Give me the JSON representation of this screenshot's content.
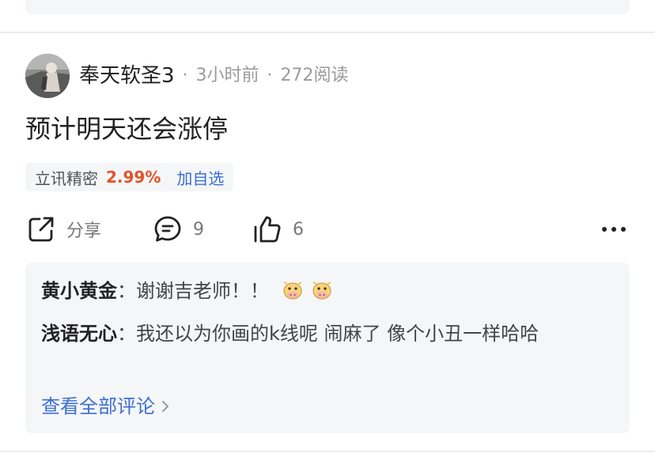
{
  "post": {
    "author": {
      "name": "奉天软圣3",
      "avatar_icon": "avatar-photo"
    },
    "time": "3小时前",
    "reads": "272阅读",
    "content": "预计明天还会涨停",
    "stock": {
      "name": "立讯精密",
      "change": "2.99%",
      "change_color": "#e0542a",
      "add_label": "加自选"
    },
    "actions": {
      "share_label": "分享",
      "comment_count": "9",
      "like_count": "6",
      "more_icon": "more-dots-icon"
    },
    "comments": [
      {
        "author": "黄小黄金",
        "separator": "：",
        "text": "谢谢吉老师！！",
        "emoji": "cow-face-emoji"
      },
      {
        "author": "浅语无心",
        "separator": "：",
        "text": "我还以为你画的k线呢 闹麻了 像个小丑一样哈哈"
      }
    ],
    "view_all_label": "查看全部评论"
  },
  "colors": {
    "accent_blue": "#3b6fd1",
    "rise_red": "#e0542a",
    "card_bg": "#f5f6f8"
  }
}
